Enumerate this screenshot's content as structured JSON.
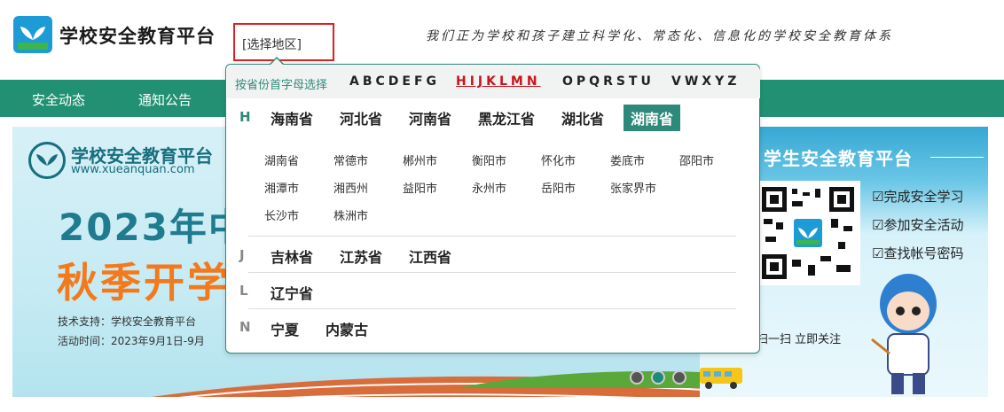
{
  "header": {
    "site_title": "学校安全教育平台",
    "region_button": "[选择地区]",
    "slogan": "我们正为学校和孩子建立科学化、常态化、信息化的学校安全教育体系"
  },
  "nav": {
    "items": [
      "安全动态",
      "通知公告"
    ]
  },
  "banner": {
    "logo_title": "学校安全教育平台",
    "logo_url": "www.xueanquan.com",
    "year_text": "2023年中",
    "sub_text": "秋季开学",
    "tech_support": "技术支持：学校安全教育平台",
    "activity_time": "活动时间：2023年9月1日-9月"
  },
  "right_panel": {
    "title": "学生安全教育平台",
    "checks": [
      "☑完成安全学习",
      "☑参加安全活动",
      "☑查找帐号密码"
    ],
    "scan_text": "扫一扫  立即关注"
  },
  "dropdown": {
    "label": "按省份首字母选择",
    "letter_groups": [
      "ABCDEFG",
      "HIJKLMN",
      "OPQRSTU",
      "VWXYZ"
    ],
    "active_letter_group": "HIJKLMN",
    "groups": [
      {
        "letter": "H",
        "provinces": [
          "海南省",
          "河北省",
          "河南省",
          "黑龙江省",
          "湖北省",
          "湖南省"
        ],
        "active": "湖南省",
        "cities": [
          "湖南省",
          "常德市",
          "郴州市",
          "衡阳市",
          "怀化市",
          "娄底市",
          "邵阳市",
          "湘潭市",
          "湘西州",
          "益阳市",
          "永州市",
          "岳阳市",
          "张家界市",
          "长沙市",
          "株洲市"
        ]
      },
      {
        "letter": "J",
        "provinces": [
          "吉林省",
          "江苏省",
          "江西省"
        ]
      },
      {
        "letter": "L",
        "provinces": [
          "辽宁省"
        ]
      },
      {
        "letter": "N",
        "provinces": [
          "宁夏",
          "内蒙古"
        ]
      }
    ]
  },
  "colors": {
    "brand_green": "#229173",
    "accent_red": "#c9151e"
  }
}
